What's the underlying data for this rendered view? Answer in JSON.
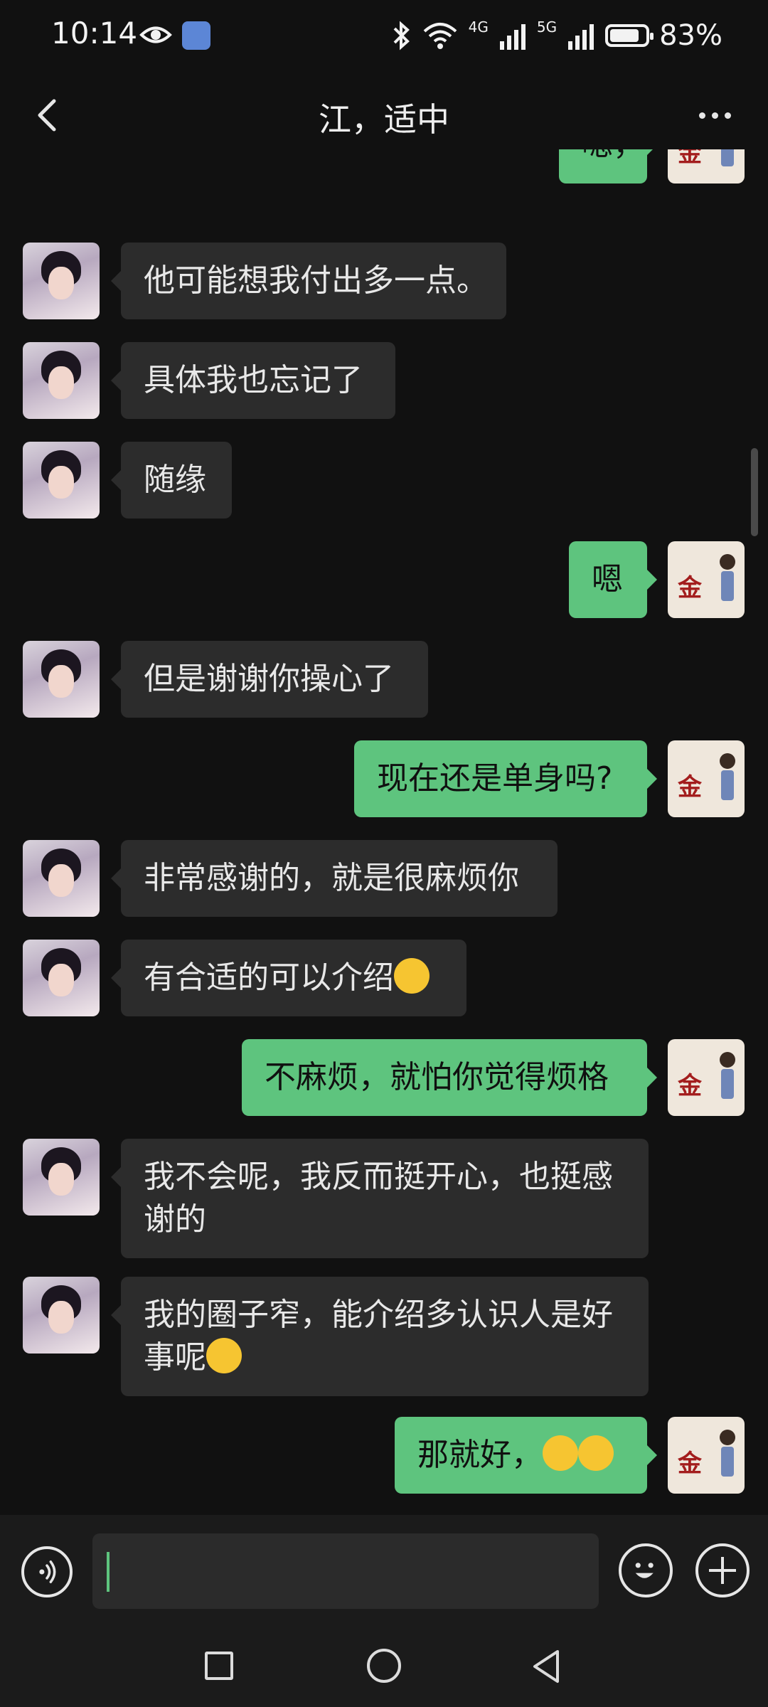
{
  "status_bar": {
    "time": "10:14",
    "network_4g": "4G",
    "network_5g": "5G",
    "battery_level": 0.83,
    "battery": "83%"
  },
  "header": {
    "title": "江，适中"
  },
  "messages": [
    {
      "side": "out",
      "text": "嗯，"
    },
    {
      "side": "in",
      "text": "他可能想我付出多一点。"
    },
    {
      "side": "in",
      "text": "具体我也忘记了"
    },
    {
      "side": "in",
      "text": "随缘"
    },
    {
      "side": "out",
      "text": "嗯"
    },
    {
      "side": "in",
      "text": "但是谢谢你操心了"
    },
    {
      "side": "out",
      "text": "现在还是单身吗?"
    },
    {
      "side": "in",
      "text": "非常感谢的，就是很麻烦你"
    },
    {
      "side": "in",
      "text": "有合适的可以介绍",
      "emoji": "laughing-crying-emoji"
    },
    {
      "side": "out",
      "text": "不麻烦，就怕你觉得烦格"
    },
    {
      "side": "in",
      "text": "我不会呢，我反而挺开心，也挺感谢的"
    },
    {
      "side": "in",
      "text": "我的圈子窄，能介绍多认识人是好事呢",
      "emoji": "smiling-emoji"
    },
    {
      "side": "out",
      "text": "那就好，",
      "emoji": "grinning-emoji"
    }
  ],
  "avatar_me_text": "金",
  "input": {
    "value": "",
    "placeholder": ""
  },
  "icons": {
    "voice": "voice-icon",
    "emoji": "emoji-icon",
    "plus": "plus-icon",
    "back": "back-icon",
    "more": "more-icon",
    "nav_recent": "square-icon",
    "nav_home": "circle-icon",
    "nav_back": "triangle-back-icon"
  },
  "colors": {
    "outgoing_bubble": "#5ec47e",
    "incoming_bubble": "#2c2c2c",
    "background": "#111111"
  }
}
